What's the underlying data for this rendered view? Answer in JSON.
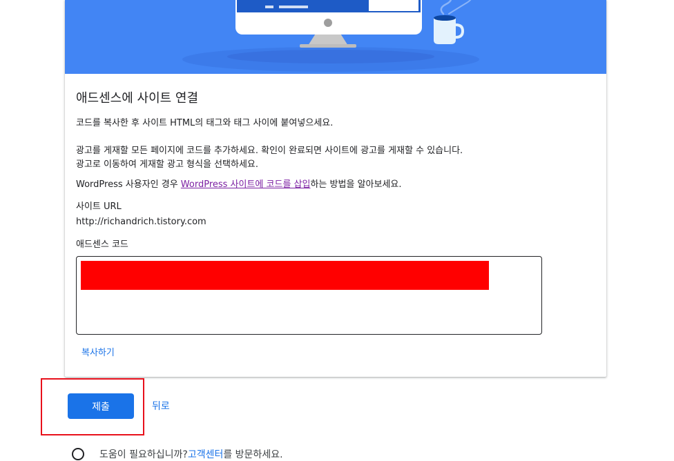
{
  "card": {
    "title": "애드센스에 사이트 연결",
    "instruction": "코드를 복사한 후 사이트 HTML의 태그와 태그 사이에 붙여넣으세요.",
    "placement_line1": "광고를 게재할 모든 페이지에 코드를 추가하세요. 확인이 완료되면 사이트에 광고를 게재할 수 있습니다.",
    "placement_line2": "광고로 이동하여 게재할 광고 형식을 선택하세요.",
    "wordpress_prefix": "WordPress 사용자인 경우 ",
    "wordpress_link": "WordPress 사이트에 코드를 삽입",
    "wordpress_suffix": "하는 방법을 알아보세요.",
    "site_url_label": "사이트 URL",
    "site_url_value": "http://richandrich.tistory.com",
    "code_label": "애드센스 코드",
    "copy_button": "복사하기"
  },
  "actions": {
    "submit_label": "제출",
    "back_label": "뒤로"
  },
  "help": {
    "prefix": "도움이 필요하십니까? ",
    "link": "고객센터",
    "suffix": "를 방문하세요."
  },
  "colors": {
    "hero_bg": "#4285f4",
    "primary": "#1a73e8",
    "highlight_border": "#e8101b",
    "redaction": "#ff0000"
  }
}
